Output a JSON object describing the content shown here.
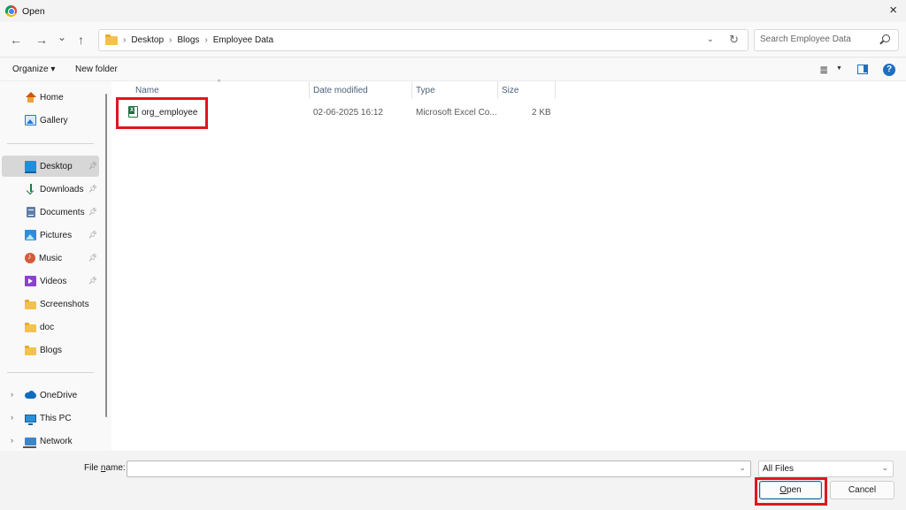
{
  "window": {
    "title": "Open",
    "close_icon": "×"
  },
  "nav": {
    "back": "←",
    "forward": "→",
    "recent": "⌄",
    "up": "↑",
    "breadcrumbs": [
      "Desktop",
      "Blogs",
      "Employee Data"
    ],
    "refresh": "↻"
  },
  "search": {
    "placeholder": "Search Employee Data"
  },
  "toolbar": {
    "organize": "Organize ▾",
    "new_folder": "New folder",
    "help": "?"
  },
  "sidebar": {
    "quick": [
      {
        "label": "Home"
      },
      {
        "label": "Gallery"
      }
    ],
    "pinned": [
      {
        "label": "Desktop"
      },
      {
        "label": "Downloads"
      },
      {
        "label": "Documents"
      },
      {
        "label": "Pictures"
      },
      {
        "label": "Music"
      },
      {
        "label": "Videos"
      }
    ],
    "folders": [
      {
        "label": "Screenshots"
      },
      {
        "label": "doc"
      },
      {
        "label": "Blogs"
      }
    ],
    "locations": [
      {
        "label": "OneDrive"
      },
      {
        "label": "This PC"
      },
      {
        "label": "Network"
      }
    ]
  },
  "columns": {
    "name": "Name",
    "date": "Date modified",
    "type": "Type",
    "size": "Size"
  },
  "files": [
    {
      "name": "org_employee",
      "date": "02-06-2025 16:12",
      "type": "Microsoft Excel Co...",
      "size": "2 KB"
    }
  ],
  "footer": {
    "file_name_label_pre": "File ",
    "file_name_label_accel": "n",
    "file_name_label_post": "ame:",
    "file_name_value": "",
    "filter": "All Files",
    "open_accel": "O",
    "open_rest": "pen",
    "cancel": "Cancel"
  },
  "colors": {
    "highlight": "#e0161e",
    "accent": "#1f6fbf"
  }
}
